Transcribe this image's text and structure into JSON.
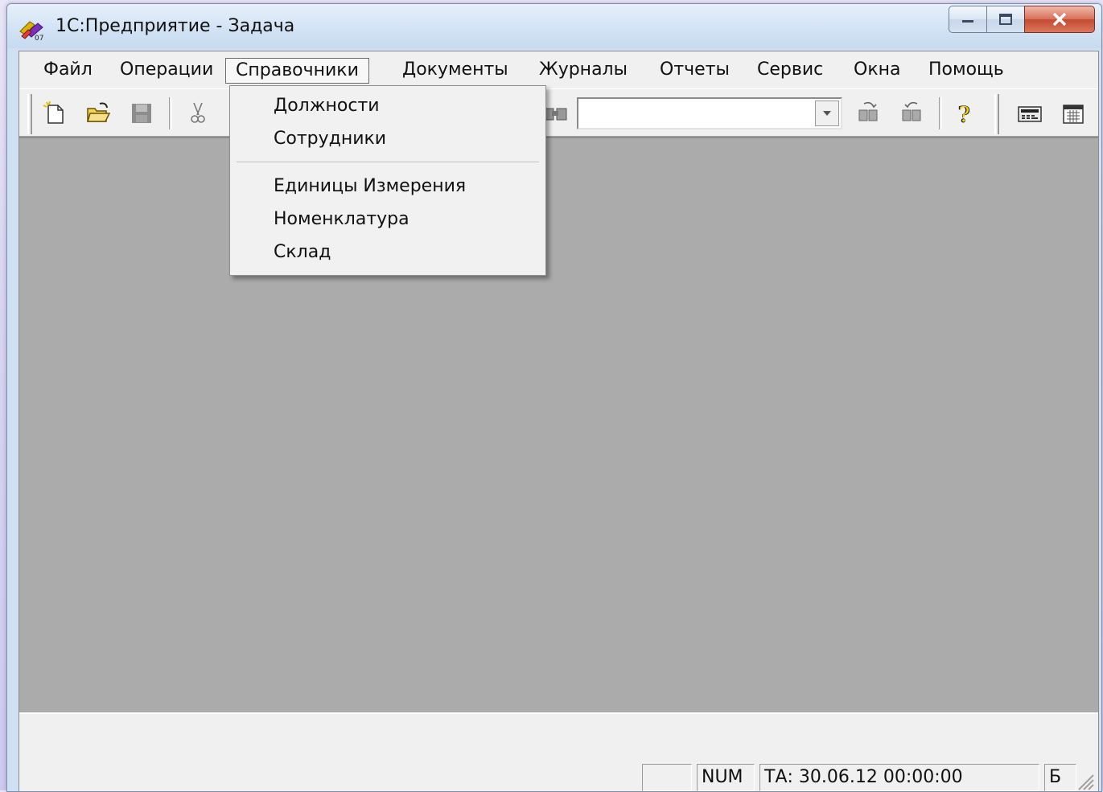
{
  "window": {
    "title": "1С:Предприятие - Задача"
  },
  "menu": {
    "items": [
      {
        "label": "Файл"
      },
      {
        "label": "Операции"
      },
      {
        "label": "Справочники",
        "active": true
      },
      {
        "label": "Документы"
      },
      {
        "label": "Журналы"
      },
      {
        "label": "Отчеты"
      },
      {
        "label": "Сервис"
      },
      {
        "label": "Окна"
      },
      {
        "label": "Помощь"
      }
    ]
  },
  "dropdown": {
    "items": [
      {
        "label": "Должности"
      },
      {
        "label": "Сотрудники"
      },
      {
        "label": "Единицы Измерения"
      },
      {
        "label": "Номенклатура"
      },
      {
        "label": "Склад"
      }
    ]
  },
  "toolbar": {
    "icons": [
      "new-document-icon",
      "open-folder-icon",
      "save-disk-icon",
      "cut-scissors-icon",
      "find-binoculars-icon",
      "find-next-icon",
      "find-previous-icon",
      "help-icon",
      "calculator-icon",
      "calendar-icon"
    ],
    "search_value": ""
  },
  "status": {
    "empty_panel": "",
    "num": "NUM",
    "ta": "ТА: 30.06.12  00:00:00",
    "lang": "Б"
  },
  "colors": {
    "workspace": "#ababab",
    "chrome": "#f0f0f0",
    "close_button": "#c24a2f"
  }
}
